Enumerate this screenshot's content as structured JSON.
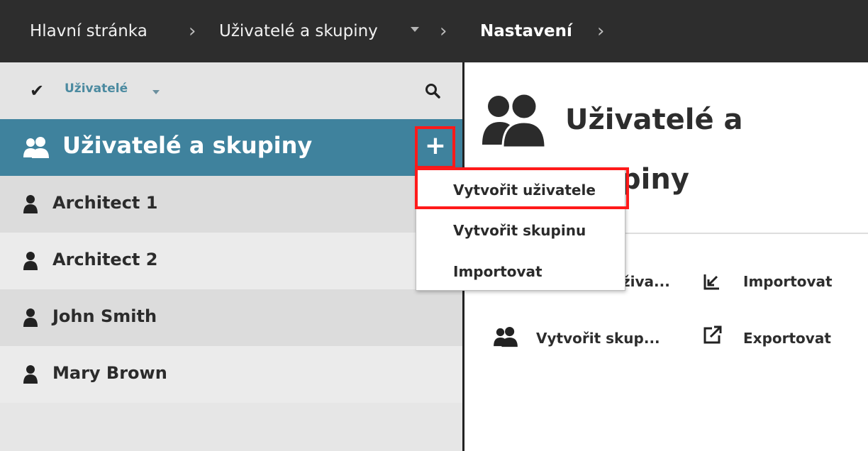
{
  "breadcrumb": {
    "items": [
      "Hlavní stránka",
      "Uživatelé a skupiny",
      "Nastavení"
    ]
  },
  "left": {
    "filter_label": "Uživatelé",
    "group_title": "Uživatelé a skupiny",
    "users": [
      "Architect 1",
      "Architect 2",
      "John Smith",
      "Mary Brown"
    ]
  },
  "right": {
    "title_line1": "Uživatelé a",
    "title_line2": "piny",
    "actions": {
      "create_user": "živa...",
      "import": "Importovat",
      "create_group": "Vytvořit skup...",
      "export": "Exportovat"
    }
  },
  "menu": {
    "items": [
      "Vytvořit uživatele",
      "Vytvořit skupinu",
      "Importovat"
    ]
  },
  "colors": {
    "topbar": "#2d2d2d",
    "accent": "#3f829d",
    "highlight": "#ff1a1a"
  },
  "icons": [
    "check-icon",
    "search-icon",
    "users-group-icon",
    "plus-icon",
    "user-icon",
    "import-icon",
    "export-icon"
  ]
}
